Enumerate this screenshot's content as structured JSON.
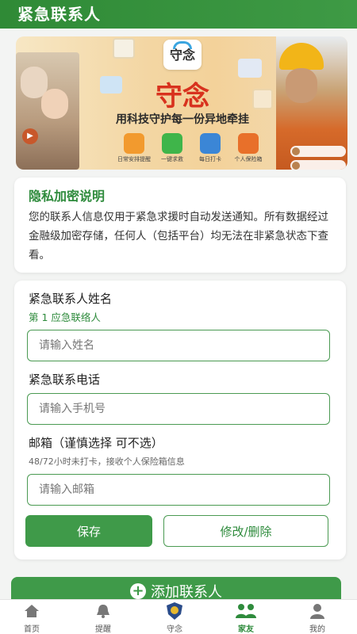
{
  "header": {
    "title": "紧急联系人"
  },
  "banner": {
    "logo_text": "守念",
    "brand": "守念",
    "slogan": "用科技守护每一份异地牵挂",
    "features": [
      {
        "label": "日常安排提醒",
        "color": "#f29a2e"
      },
      {
        "label": "一键求救",
        "color": "#3fb54a"
      },
      {
        "label": "每日打卡",
        "color": "#3b86d6"
      },
      {
        "label": "个人保险箱",
        "color": "#e8702a"
      }
    ]
  },
  "privacy": {
    "title": "隐私加密说明",
    "text": "您的联系人信息仅用于紧急求援时自动发送通知。所有数据经过金融级加密存储，任何人（包括平台）均无法在非紧急状态下查看。"
  },
  "form": {
    "name_label": "紧急联系人姓名",
    "contact_index": "第 1 应急联络人",
    "name_placeholder": "请输入姓名",
    "phone_label": "紧急联系电话",
    "phone_placeholder": "请输入手机号",
    "email_label": "邮箱（谨慎选择 可不选）",
    "email_hint": "48/72小时未打卡，接收个人保险箱信息",
    "email_placeholder": "请输入邮箱",
    "save_label": "保存",
    "edit_label": "修改/删除"
  },
  "add_contact": {
    "label": "添加联系人"
  },
  "tabbar": {
    "items": [
      {
        "label": "首页",
        "icon": "home-icon"
      },
      {
        "label": "提醒",
        "icon": "bell-icon"
      },
      {
        "label": "守念",
        "icon": "shield-badge-icon"
      },
      {
        "label": "家友",
        "icon": "family-icon",
        "active": true
      },
      {
        "label": "我的",
        "icon": "user-icon"
      }
    ]
  },
  "colors": {
    "primary": "#3f9a49",
    "brand_red": "#d8321e"
  }
}
